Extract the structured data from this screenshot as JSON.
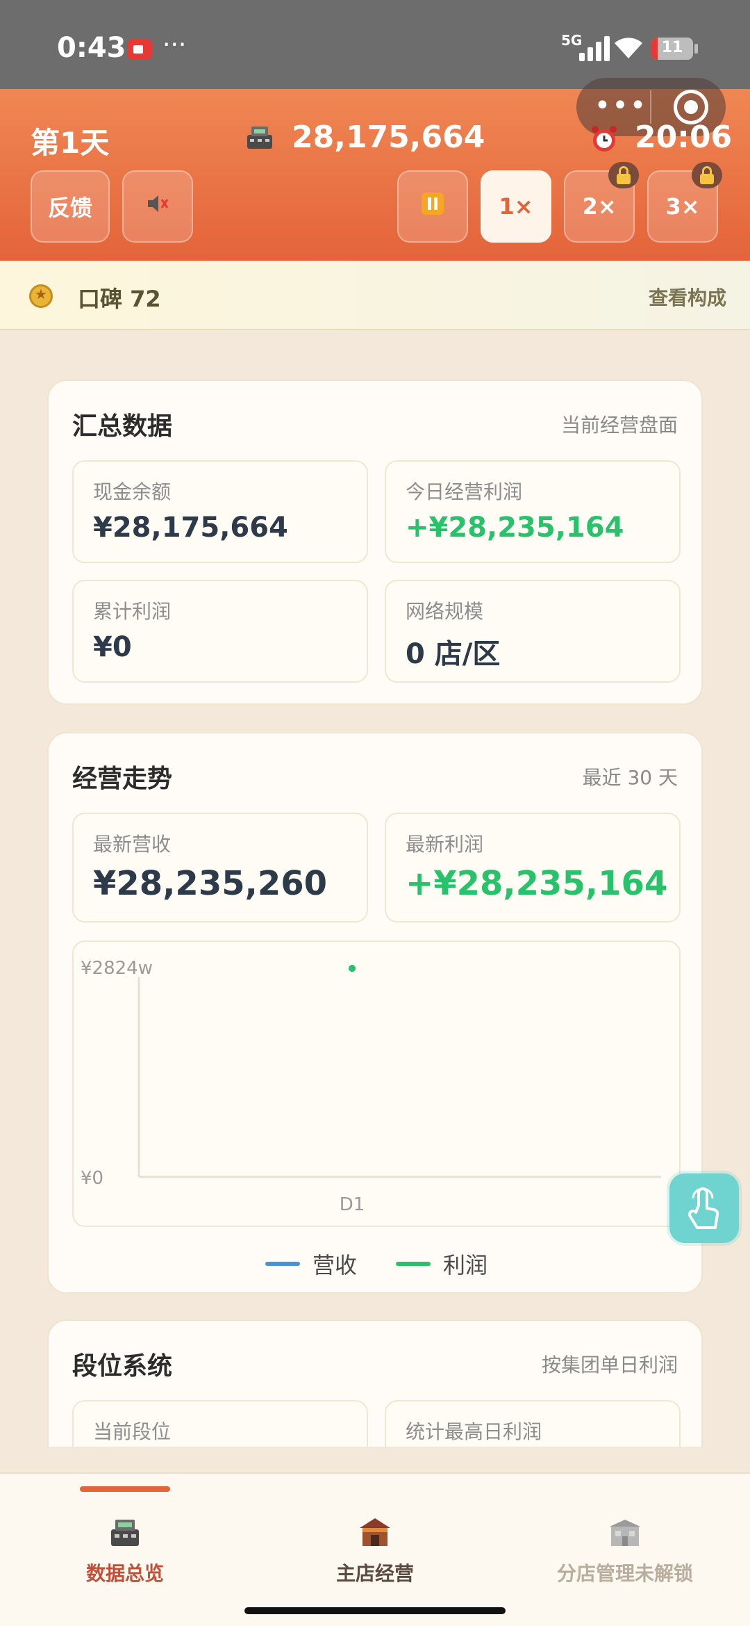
{
  "status_bar": {
    "time": "0:43",
    "more": "···",
    "network": "5G",
    "battery": "11"
  },
  "header": {
    "day": "第1天",
    "money": "28,175,664",
    "clock": "20:06",
    "feedback": "反馈",
    "speeds": [
      "1×",
      "2×",
      "3×"
    ],
    "icons": {
      "money": "cash-register-icon",
      "clock": "alarm-clock-icon",
      "mute": "speaker-muted-icon",
      "pause": "pause-icon"
    }
  },
  "reputation": {
    "label": "口碑 72",
    "link": "查看构成"
  },
  "summary": {
    "title": "汇总数据",
    "subtitle": "当前经营盘面",
    "tiles": [
      {
        "label": "现金余额",
        "value": "¥28,175,664"
      },
      {
        "label": "今日经营利润",
        "value": "+¥28,235,164"
      },
      {
        "label": "累计利润",
        "value": "¥0"
      },
      {
        "label": "网络规模",
        "value": "0 店/区"
      }
    ]
  },
  "trend": {
    "title": "经营走势",
    "subtitle": "最近 30 天",
    "tiles": [
      {
        "label": "最新营收",
        "value": "¥28,235,260"
      },
      {
        "label": "最新利润",
        "value": "+¥28,235,164"
      }
    ]
  },
  "chart_data": {
    "type": "line",
    "categories": [
      "D1"
    ],
    "series": [
      {
        "name": "营收",
        "values": [
          28235260
        ],
        "color": "#4a90e2"
      },
      {
        "name": "利润",
        "values": [
          28235164
        ],
        "color": "#27c26a"
      }
    ],
    "y_tick_labels": [
      "¥2824w",
      "¥0"
    ],
    "ylim": [
      0,
      28235260
    ],
    "grid": false,
    "legend": "bottom-center"
  },
  "rank": {
    "title": "段位系统",
    "subtitle": "按集团单日利润",
    "tiles": [
      {
        "label": "当前段位"
      },
      {
        "label": "统计最高日利润"
      }
    ]
  },
  "bottom_nav": [
    {
      "label": "数据总览",
      "icon": "cash-register-icon",
      "active": true
    },
    {
      "label": "主店经营",
      "icon": "restaurant-shop-icon",
      "active": false
    },
    {
      "label": "分店管理未解锁",
      "icon": "branch-building-icon",
      "active": false
    }
  ],
  "colors": {
    "accent": "#e4643a",
    "profit": "#27c26a",
    "revenue": "#4a90e2",
    "background": "#f3e8d9"
  }
}
